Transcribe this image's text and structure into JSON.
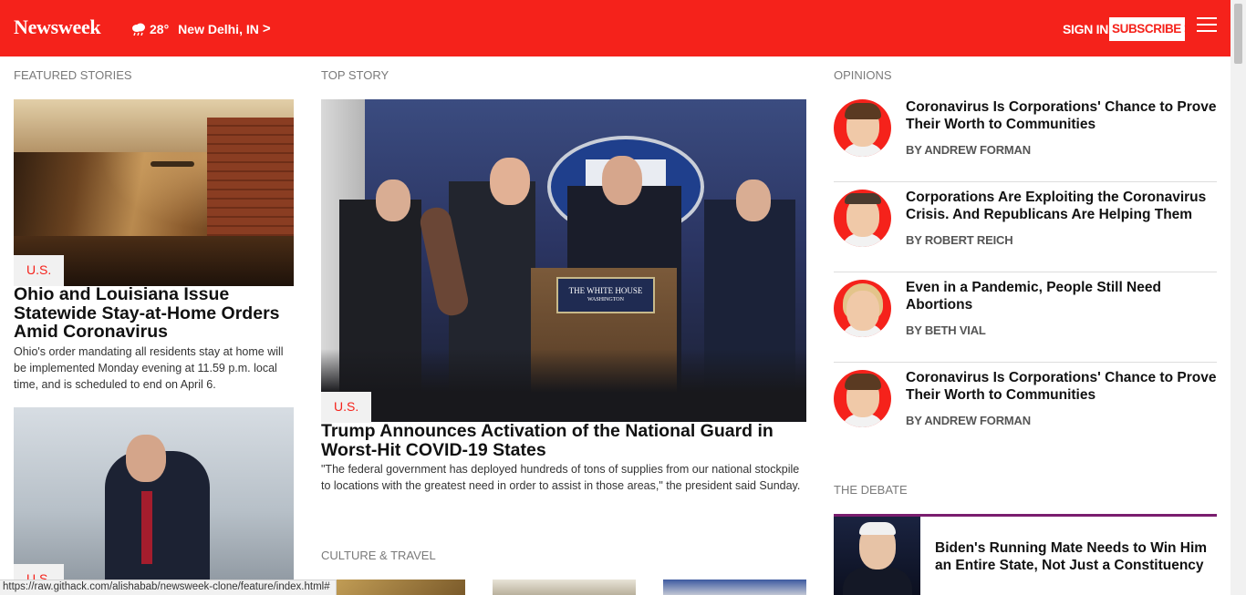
{
  "header": {
    "logo": "Newsweek",
    "weather_icon": "cloud-rain-icon",
    "temperature": "28°",
    "location": "New Delhi, IN",
    "location_chevron": ">",
    "sign_in": "SIGN IN",
    "subscribe": "SUBSCRIBE",
    "subscribe_chevron": ">",
    "menu_icon": "hamburger-menu-icon",
    "colors": {
      "brand": "#f5221b",
      "accent_debate": "#7a1d6e"
    }
  },
  "featured": {
    "section_label": "FEATURED STORIES",
    "stories": [
      {
        "tag": "U.S.",
        "title": "Ohio and Louisiana Issue Statewide Stay-at-Home Orders Amid Coronavirus",
        "summary": "Ohio's order mandating all residents stay at home will be implemented Monday evening at 11.59 p.m. local time, and is scheduled to end on April 6."
      },
      {
        "tag": "U.S."
      }
    ]
  },
  "top_story": {
    "section_label": "TOP STORY",
    "tag": "U.S.",
    "plaque_line1": "THE WHITE HOUSE",
    "plaque_line2": "WASHINGTON",
    "title": "Trump Announces Activation of the National Guard in Worst-Hit COVID-19 States",
    "summary": "\"The federal government has deployed hundreds of tons of supplies from our national stockpile to locations with the greatest need in order to assist in those areas,\" the president said Sunday."
  },
  "culture": {
    "section_label": "CULTURE & TRAVEL"
  },
  "opinions": {
    "section_label": "OPINIONS",
    "items": [
      {
        "title": "Coronavirus Is Corporations' Chance to Prove Their Worth to Communities",
        "author": "BY ANDREW FORMAN"
      },
      {
        "title": "Corporations Are Exploiting the Coronavirus Crisis. And Republicans Are Helping Them",
        "author": "BY ROBERT REICH"
      },
      {
        "title": "Even in a Pandemic, People Still Need Abortions",
        "author": "BY BETH VIAL"
      },
      {
        "title": "Coronavirus Is Corporations' Chance to Prove Their Worth to Communities",
        "author": "BY ANDREW FORMAN"
      }
    ]
  },
  "debate": {
    "section_label": "THE DEBATE",
    "title": "Biden's Running Mate Needs to Win Him an Entire State, Not Just a Constituency"
  },
  "status_bar": {
    "url": "https://raw.githack.com/alishabab/newsweek-clone/feature/index.html#"
  }
}
